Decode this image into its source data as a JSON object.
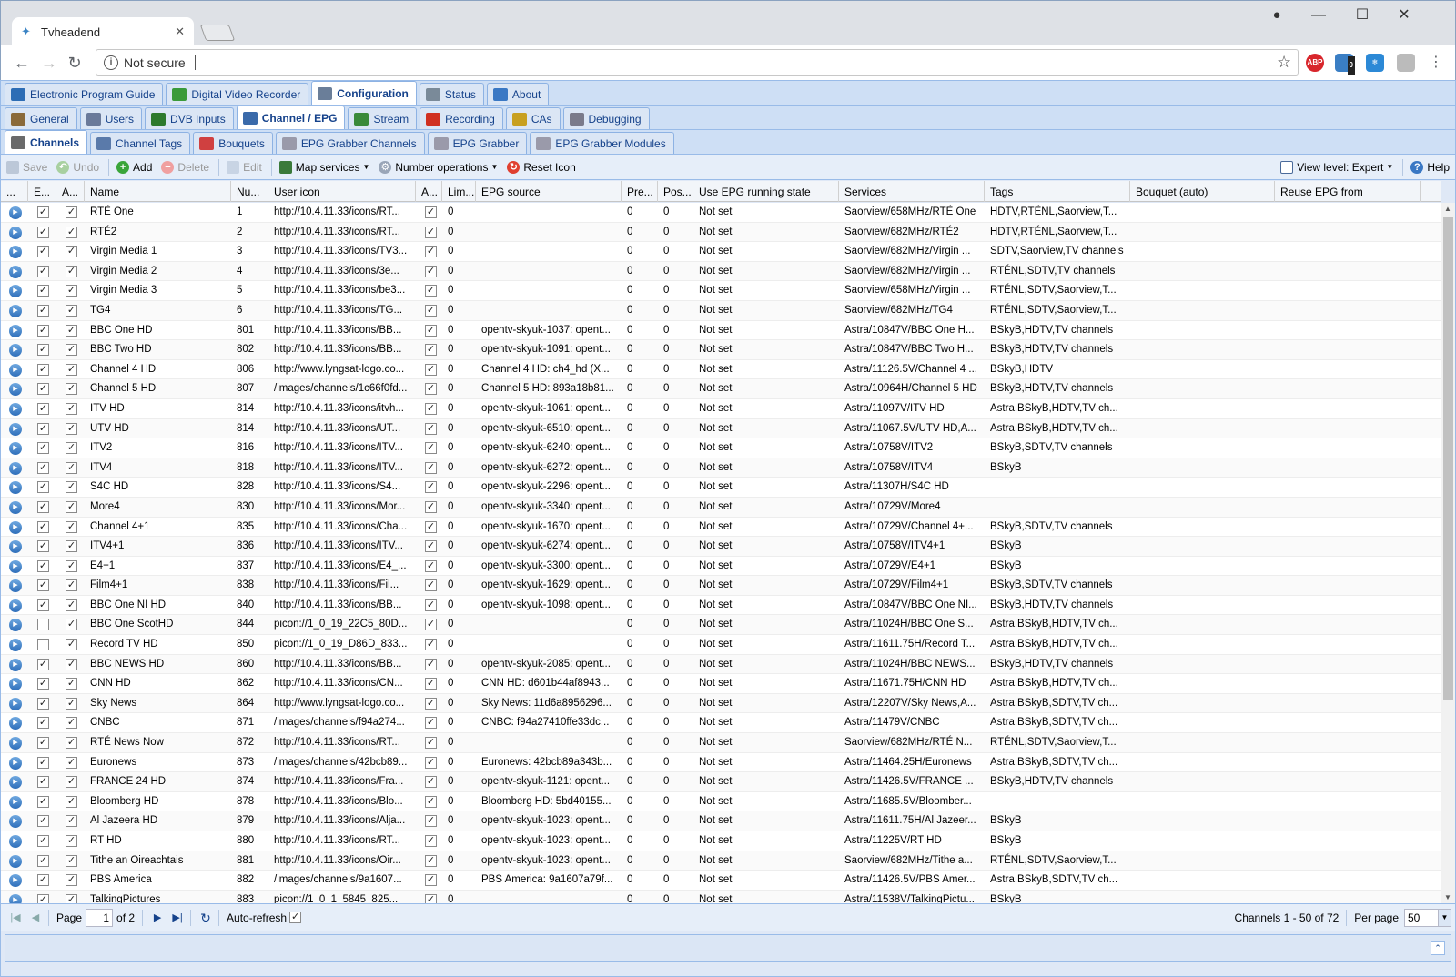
{
  "browser": {
    "tab_title": "Tvheadend",
    "address_security": "Not secure",
    "ext_abp": "ABP",
    "ext_badge": "0"
  },
  "main_tabs": [
    {
      "label": "Electronic Program Guide",
      "icon": "epg-icon",
      "color": "#2d6db5"
    },
    {
      "label": "Digital Video Recorder",
      "icon": "download-icon",
      "color": "#3a9a3a"
    },
    {
      "label": "Configuration",
      "icon": "wrench-icon",
      "color": "#6a7e99",
      "active": true
    },
    {
      "label": "Status",
      "icon": "eye-icon",
      "color": "#7a8a99"
    },
    {
      "label": "About",
      "icon": "info-icon",
      "color": "#3a78c4"
    }
  ],
  "config_tabs": [
    {
      "label": "General",
      "icon": "tools-icon",
      "color": "#8a6a3a"
    },
    {
      "label": "Users",
      "icon": "users-icon",
      "color": "#6a7a9a"
    },
    {
      "label": "DVB Inputs",
      "icon": "card-icon",
      "color": "#2d7a2d"
    },
    {
      "label": "Channel / EPG",
      "icon": "tv-icon",
      "color": "#3a6aaa",
      "active": true
    },
    {
      "label": "Stream",
      "icon": "stream-icon",
      "color": "#3a8a3a"
    },
    {
      "label": "Recording",
      "icon": "rec-icon",
      "color": "#d03020"
    },
    {
      "label": "CAs",
      "icon": "key-icon",
      "color": "#c8a020"
    },
    {
      "label": "Debugging",
      "icon": "bug-icon",
      "color": "#7a7a8a"
    }
  ],
  "channel_tabs": [
    {
      "label": "Channels",
      "icon": "phone-icon",
      "color": "#6a6a6a",
      "active": true
    },
    {
      "label": "Channel Tags",
      "icon": "tag-icon",
      "color": "#5a7aaa"
    },
    {
      "label": "Bouquets",
      "icon": "grid-icon",
      "color": "#d04040"
    },
    {
      "label": "EPG Grabber Channels",
      "icon": "gear-icon",
      "color": "#9a9aaa"
    },
    {
      "label": "EPG Grabber",
      "icon": "gear-icon",
      "color": "#9a9aaa"
    },
    {
      "label": "EPG Grabber Modules",
      "icon": "gear-icon",
      "color": "#9a9aaa"
    }
  ],
  "toolbar": {
    "save": "Save",
    "undo": "Undo",
    "add": "Add",
    "delete": "Delete",
    "edit": "Edit",
    "map_services": "Map services",
    "number_operations": "Number operations",
    "reset_icon": "Reset Icon",
    "view_level": "View level: Expert",
    "help": "Help"
  },
  "columns": [
    {
      "label": "...",
      "w": 30
    },
    {
      "label": "E...",
      "w": 31
    },
    {
      "label": "A...",
      "w": 31
    },
    {
      "label": "Name",
      "w": 161
    },
    {
      "label": "Nu...",
      "w": 41
    },
    {
      "label": "User icon",
      "w": 162
    },
    {
      "label": "A...",
      "w": 29
    },
    {
      "label": "Lim...",
      "w": 37
    },
    {
      "label": "EPG source",
      "w": 160
    },
    {
      "label": "Pre...",
      "w": 40
    },
    {
      "label": "Pos...",
      "w": 39
    },
    {
      "label": "Use EPG running state",
      "w": 160
    },
    {
      "label": "Services",
      "w": 160
    },
    {
      "label": "Tags",
      "w": 160
    },
    {
      "label": "Bouquet (auto)",
      "w": 159
    },
    {
      "label": "Reuse EPG from",
      "w": 160
    }
  ],
  "rows": [
    {
      "en": true,
      "auto": true,
      "name": "RTÉ One",
      "num": "1",
      "icon": "http://10.4.11.33/icons/RT...",
      "ai": true,
      "lim": "0",
      "epg": "",
      "pre": "0",
      "pos": "0",
      "state": "Not set",
      "svc": "Saorview/658MHz/RTÉ One",
      "tags": "HDTV,RTÉNL,Saorview,T..."
    },
    {
      "en": true,
      "auto": true,
      "name": "RTÉ2",
      "num": "2",
      "icon": "http://10.4.11.33/icons/RT...",
      "ai": true,
      "lim": "0",
      "epg": "",
      "pre": "0",
      "pos": "0",
      "state": "Not set",
      "svc": "Saorview/682MHz/RTÉ2",
      "tags": "HDTV,RTÉNL,Saorview,T..."
    },
    {
      "en": true,
      "auto": true,
      "name": "Virgin Media 1",
      "num": "3",
      "icon": "http://10.4.11.33/icons/TV3...",
      "ai": true,
      "lim": "0",
      "epg": "",
      "pre": "0",
      "pos": "0",
      "state": "Not set",
      "svc": "Saorview/682MHz/Virgin ...",
      "tags": "SDTV,Saorview,TV channels"
    },
    {
      "en": true,
      "auto": true,
      "name": "Virgin Media 2",
      "num": "4",
      "icon": "http://10.4.11.33/icons/3e...",
      "ai": true,
      "lim": "0",
      "epg": "",
      "pre": "0",
      "pos": "0",
      "state": "Not set",
      "svc": "Saorview/682MHz/Virgin ...",
      "tags": "RTÉNL,SDTV,TV channels"
    },
    {
      "en": true,
      "auto": true,
      "name": "Virgin Media 3",
      "num": "5",
      "icon": "http://10.4.11.33/icons/be3...",
      "ai": true,
      "lim": "0",
      "epg": "",
      "pre": "0",
      "pos": "0",
      "state": "Not set",
      "svc": "Saorview/658MHz/Virgin ...",
      "tags": "RTÉNL,SDTV,Saorview,T..."
    },
    {
      "en": true,
      "auto": true,
      "name": "TG4",
      "num": "6",
      "icon": "http://10.4.11.33/icons/TG...",
      "ai": true,
      "lim": "0",
      "epg": "",
      "pre": "0",
      "pos": "0",
      "state": "Not set",
      "svc": "Saorview/682MHz/TG4",
      "tags": "RTÉNL,SDTV,Saorview,T..."
    },
    {
      "en": true,
      "auto": true,
      "name": "BBC One HD",
      "num": "801",
      "icon": "http://10.4.11.33/icons/BB...",
      "ai": true,
      "lim": "0",
      "epg": "opentv-skyuk-1037: opent...",
      "pre": "0",
      "pos": "0",
      "state": "Not set",
      "svc": "Astra/10847V/BBC One H...",
      "tags": "BSkyB,HDTV,TV channels"
    },
    {
      "en": true,
      "auto": true,
      "name": "BBC Two HD",
      "num": "802",
      "icon": "http://10.4.11.33/icons/BB...",
      "ai": true,
      "lim": "0",
      "epg": "opentv-skyuk-1091: opent...",
      "pre": "0",
      "pos": "0",
      "state": "Not set",
      "svc": "Astra/10847V/BBC Two H...",
      "tags": "BSkyB,HDTV,TV channels"
    },
    {
      "en": true,
      "auto": true,
      "name": "Channel 4 HD",
      "num": "806",
      "icon": "http://www.lyngsat-logo.co...",
      "ai": true,
      "lim": "0",
      "epg": "Channel 4 HD: ch4_hd (X...",
      "pre": "0",
      "pos": "0",
      "state": "Not set",
      "svc": "Astra/11126.5V/Channel 4 ...",
      "tags": "BSkyB,HDTV"
    },
    {
      "en": true,
      "auto": true,
      "name": "Channel 5 HD",
      "num": "807",
      "icon": "/images/channels/1c66f0fd...",
      "ai": true,
      "lim": "0",
      "epg": "Channel 5 HD: 893a18b81...",
      "pre": "0",
      "pos": "0",
      "state": "Not set",
      "svc": "Astra/10964H/Channel 5 HD",
      "tags": "BSkyB,HDTV,TV channels"
    },
    {
      "en": true,
      "auto": true,
      "name": "ITV HD",
      "num": "814",
      "icon": "http://10.4.11.33/icons/itvh...",
      "ai": true,
      "lim": "0",
      "epg": "opentv-skyuk-1061: opent...",
      "pre": "0",
      "pos": "0",
      "state": "Not set",
      "svc": "Astra/11097V/ITV HD",
      "tags": "Astra,BSkyB,HDTV,TV ch..."
    },
    {
      "en": true,
      "auto": true,
      "name": "UTV HD",
      "num": "814",
      "icon": "http://10.4.11.33/icons/UT...",
      "ai": true,
      "lim": "0",
      "epg": "opentv-skyuk-6510: opent...",
      "pre": "0",
      "pos": "0",
      "state": "Not set",
      "svc": "Astra/11067.5V/UTV HD,A...",
      "tags": "Astra,BSkyB,HDTV,TV ch..."
    },
    {
      "en": true,
      "auto": true,
      "name": "ITV2",
      "num": "816",
      "icon": "http://10.4.11.33/icons/ITV...",
      "ai": true,
      "lim": "0",
      "epg": "opentv-skyuk-6240: opent...",
      "pre": "0",
      "pos": "0",
      "state": "Not set",
      "svc": "Astra/10758V/ITV2",
      "tags": "BSkyB,SDTV,TV channels"
    },
    {
      "en": true,
      "auto": true,
      "name": "ITV4",
      "num": "818",
      "icon": "http://10.4.11.33/icons/ITV...",
      "ai": true,
      "lim": "0",
      "epg": "opentv-skyuk-6272: opent...",
      "pre": "0",
      "pos": "0",
      "state": "Not set",
      "svc": "Astra/10758V/ITV4",
      "tags": "BSkyB"
    },
    {
      "en": true,
      "auto": true,
      "name": "S4C HD",
      "num": "828",
      "icon": "http://10.4.11.33/icons/S4...",
      "ai": true,
      "lim": "0",
      "epg": "opentv-skyuk-2296: opent...",
      "pre": "0",
      "pos": "0",
      "state": "Not set",
      "svc": "Astra/11307H/S4C HD",
      "tags": ""
    },
    {
      "en": true,
      "auto": true,
      "name": "More4",
      "num": "830",
      "icon": "http://10.4.11.33/icons/Mor...",
      "ai": true,
      "lim": "0",
      "epg": "opentv-skyuk-3340: opent...",
      "pre": "0",
      "pos": "0",
      "state": "Not set",
      "svc": "Astra/10729V/More4",
      "tags": ""
    },
    {
      "en": true,
      "auto": true,
      "name": "Channel 4+1",
      "num": "835",
      "icon": "http://10.4.11.33/icons/Cha...",
      "ai": true,
      "lim": "0",
      "epg": "opentv-skyuk-1670: opent...",
      "pre": "0",
      "pos": "0",
      "state": "Not set",
      "svc": "Astra/10729V/Channel 4+...",
      "tags": "BSkyB,SDTV,TV channels"
    },
    {
      "en": true,
      "auto": true,
      "name": "ITV4+1",
      "num": "836",
      "icon": "http://10.4.11.33/icons/ITV...",
      "ai": true,
      "lim": "0",
      "epg": "opentv-skyuk-6274: opent...",
      "pre": "0",
      "pos": "0",
      "state": "Not set",
      "svc": "Astra/10758V/ITV4+1",
      "tags": "BSkyB"
    },
    {
      "en": true,
      "auto": true,
      "name": "E4+1",
      "num": "837",
      "icon": "http://10.4.11.33/icons/E4_...",
      "ai": true,
      "lim": "0",
      "epg": "opentv-skyuk-3300: opent...",
      "pre": "0",
      "pos": "0",
      "state": "Not set",
      "svc": "Astra/10729V/E4+1",
      "tags": "BSkyB"
    },
    {
      "en": true,
      "auto": true,
      "name": "Film4+1",
      "num": "838",
      "icon": "http://10.4.11.33/icons/Fil...",
      "ai": true,
      "lim": "0",
      "epg": "opentv-skyuk-1629: opent...",
      "pre": "0",
      "pos": "0",
      "state": "Not set",
      "svc": "Astra/10729V/Film4+1",
      "tags": "BSkyB,SDTV,TV channels"
    },
    {
      "en": true,
      "auto": true,
      "name": "BBC One NI HD",
      "num": "840",
      "icon": "http://10.4.11.33/icons/BB...",
      "ai": true,
      "lim": "0",
      "epg": "opentv-skyuk-1098: opent...",
      "pre": "0",
      "pos": "0",
      "state": "Not set",
      "svc": "Astra/10847V/BBC One NI...",
      "tags": "BSkyB,HDTV,TV channels"
    },
    {
      "en": false,
      "auto": true,
      "name": "BBC One ScotHD",
      "num": "844",
      "icon": "picon://1_0_19_22C5_80D...",
      "ai": true,
      "lim": "0",
      "epg": "",
      "pre": "0",
      "pos": "0",
      "state": "Not set",
      "svc": "Astra/11024H/BBC One S...",
      "tags": "Astra,BSkyB,HDTV,TV ch..."
    },
    {
      "en": false,
      "auto": true,
      "name": "Record TV HD",
      "num": "850",
      "icon": "picon://1_0_19_D86D_833...",
      "ai": true,
      "lim": "0",
      "epg": "",
      "pre": "0",
      "pos": "0",
      "state": "Not set",
      "svc": "Astra/11611.75H/Record T...",
      "tags": "Astra,BSkyB,HDTV,TV ch..."
    },
    {
      "en": true,
      "auto": true,
      "name": "BBC NEWS HD",
      "num": "860",
      "icon": "http://10.4.11.33/icons/BB...",
      "ai": true,
      "lim": "0",
      "epg": "opentv-skyuk-2085: opent...",
      "pre": "0",
      "pos": "0",
      "state": "Not set",
      "svc": "Astra/11024H/BBC NEWS...",
      "tags": "BSkyB,HDTV,TV channels"
    },
    {
      "en": true,
      "auto": true,
      "name": "CNN HD",
      "num": "862",
      "icon": "http://10.4.11.33/icons/CN...",
      "ai": true,
      "lim": "0",
      "epg": "CNN HD: d601b44af8943...",
      "pre": "0",
      "pos": "0",
      "state": "Not set",
      "svc": "Astra/11671.75H/CNN HD",
      "tags": "Astra,BSkyB,HDTV,TV ch..."
    },
    {
      "en": true,
      "auto": true,
      "name": "Sky News",
      "num": "864",
      "icon": "http://www.lyngsat-logo.co...",
      "ai": true,
      "lim": "0",
      "epg": "Sky News: 11d6a8956296...",
      "pre": "0",
      "pos": "0",
      "state": "Not set",
      "svc": "Astra/12207V/Sky News,A...",
      "tags": "Astra,BSkyB,SDTV,TV ch..."
    },
    {
      "en": true,
      "auto": true,
      "name": "CNBC",
      "num": "871",
      "icon": "/images/channels/f94a274...",
      "ai": true,
      "lim": "0",
      "epg": "CNBC: f94a27410ffe33dc...",
      "pre": "0",
      "pos": "0",
      "state": "Not set",
      "svc": "Astra/11479V/CNBC",
      "tags": "Astra,BSkyB,SDTV,TV ch..."
    },
    {
      "en": true,
      "auto": true,
      "name": "RTÉ News Now",
      "num": "872",
      "icon": "http://10.4.11.33/icons/RT...",
      "ai": true,
      "lim": "0",
      "epg": "",
      "pre": "0",
      "pos": "0",
      "state": "Not set",
      "svc": "Saorview/682MHz/RTÉ N...",
      "tags": "RTÉNL,SDTV,Saorview,T..."
    },
    {
      "en": true,
      "auto": true,
      "name": "Euronews",
      "num": "873",
      "icon": "/images/channels/42bcb89...",
      "ai": true,
      "lim": "0",
      "epg": "Euronews: 42bcb89a343b...",
      "pre": "0",
      "pos": "0",
      "state": "Not set",
      "svc": "Astra/11464.25H/Euronews",
      "tags": "Astra,BSkyB,SDTV,TV ch..."
    },
    {
      "en": true,
      "auto": true,
      "name": "FRANCE 24 HD",
      "num": "874",
      "icon": "http://10.4.11.33/icons/Fra...",
      "ai": true,
      "lim": "0",
      "epg": "opentv-skyuk-1121: opent...",
      "pre": "0",
      "pos": "0",
      "state": "Not set",
      "svc": "Astra/11426.5V/FRANCE ...",
      "tags": "BSkyB,HDTV,TV channels"
    },
    {
      "en": true,
      "auto": true,
      "name": "Bloomberg HD",
      "num": "878",
      "icon": "http://10.4.11.33/icons/Blo...",
      "ai": true,
      "lim": "0",
      "epg": "Bloomberg HD: 5bd40155...",
      "pre": "0",
      "pos": "0",
      "state": "Not set",
      "svc": "Astra/11685.5V/Bloomber...",
      "tags": ""
    },
    {
      "en": true,
      "auto": true,
      "name": "Al Jazeera HD",
      "num": "879",
      "icon": "http://10.4.11.33/icons/Alja...",
      "ai": true,
      "lim": "0",
      "epg": "opentv-skyuk-1023: opent...",
      "pre": "0",
      "pos": "0",
      "state": "Not set",
      "svc": "Astra/11611.75H/Al Jazeer...",
      "tags": "BSkyB"
    },
    {
      "en": true,
      "auto": true,
      "name": "RT HD",
      "num": "880",
      "icon": "http://10.4.11.33/icons/RT...",
      "ai": true,
      "lim": "0",
      "epg": "opentv-skyuk-1023: opent...",
      "pre": "0",
      "pos": "0",
      "state": "Not set",
      "svc": "Astra/11225V/RT HD",
      "tags": "BSkyB"
    },
    {
      "en": true,
      "auto": true,
      "name": "Tithe an Oireachtais",
      "num": "881",
      "icon": "http://10.4.11.33/icons/Oir...",
      "ai": true,
      "lim": "0",
      "epg": "opentv-skyuk-1023: opent...",
      "pre": "0",
      "pos": "0",
      "state": "Not set",
      "svc": "Saorview/682MHz/Tithe a...",
      "tags": "RTÉNL,SDTV,Saorview,T..."
    },
    {
      "en": true,
      "auto": true,
      "name": "PBS America",
      "num": "882",
      "icon": "/images/channels/9a1607...",
      "ai": true,
      "lim": "0",
      "epg": "PBS America: 9a1607a79f...",
      "pre": "0",
      "pos": "0",
      "state": "Not set",
      "svc": "Astra/11426.5V/PBS Amer...",
      "tags": "Astra,BSkyB,SDTV,TV ch..."
    },
    {
      "en": true,
      "auto": true,
      "name": "TalkingPictures",
      "num": "883",
      "icon": "picon://1_0_1_5845_825...",
      "ai": true,
      "lim": "0",
      "epg": "",
      "pre": "0",
      "pos": "0",
      "state": "Not set",
      "svc": "Astra/11538V/TalkingPictu...",
      "tags": "BSkyB"
    }
  ],
  "pager": {
    "page_label": "Page",
    "page_value": "1",
    "of_label": "of 2",
    "auto_refresh": "Auto-refresh",
    "summary": "Channels 1 - 50 of 72",
    "per_page_label": "Per page",
    "per_page_value": "50"
  }
}
